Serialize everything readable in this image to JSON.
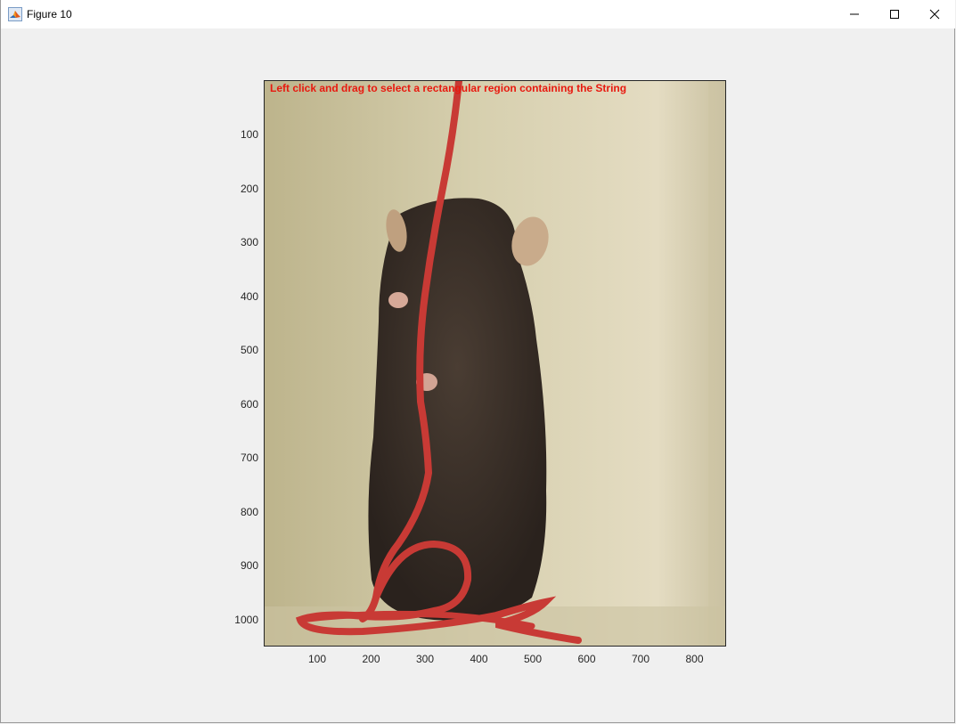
{
  "window": {
    "title": "Figure 10",
    "icon": "matlab-icon",
    "controls": [
      "minimize-icon",
      "maximize-icon",
      "close-icon"
    ]
  },
  "plot": {
    "instruction": "Left click and drag to select a rectangular region containing the String",
    "instruction_color": "#e8190f",
    "image_subject": "mouse",
    "y_ticks": [
      "100",
      "200",
      "300",
      "400",
      "500",
      "600",
      "700",
      "800",
      "900",
      "1000"
    ],
    "x_ticks": [
      "100",
      "200",
      "300",
      "400",
      "500",
      "600",
      "700",
      "800"
    ]
  }
}
